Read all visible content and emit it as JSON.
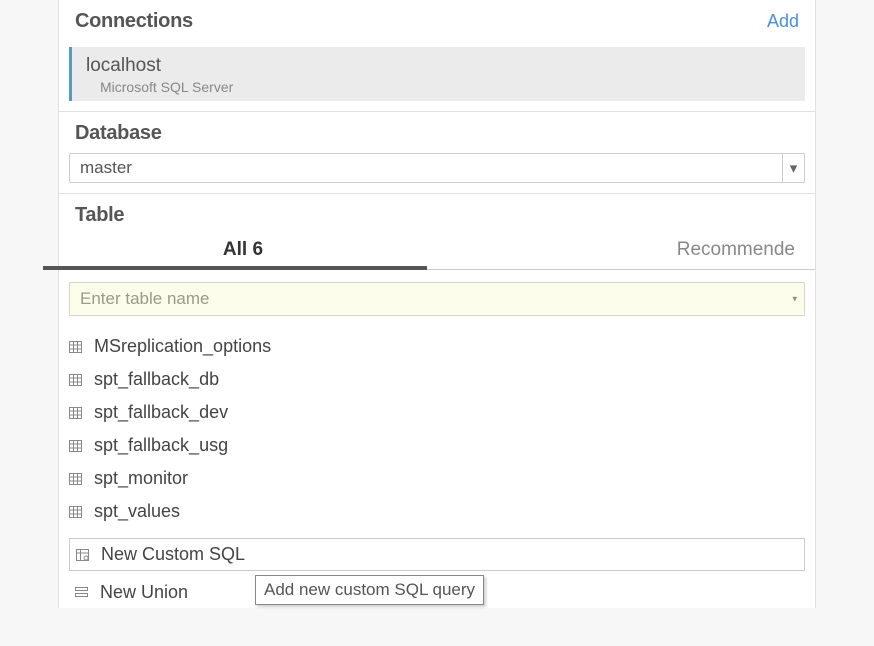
{
  "connections": {
    "title": "Connections",
    "add_label": "Add",
    "items": [
      {
        "name": "localhost",
        "type": "Microsoft SQL Server"
      }
    ]
  },
  "database": {
    "title": "Database",
    "selected": "master"
  },
  "table": {
    "title": "Table",
    "tabs": {
      "all_label": "All",
      "all_count": "6",
      "recommended_label": "Recommende"
    },
    "search_placeholder": "Enter table name",
    "items": [
      "MSreplication_options",
      "spt_fallback_db",
      "spt_fallback_dev",
      "spt_fallback_usg",
      "spt_monitor",
      "spt_values"
    ],
    "custom_sql_label": "New Custom SQL",
    "new_union_label": "New Union",
    "tooltip": "Add new custom SQL query"
  }
}
